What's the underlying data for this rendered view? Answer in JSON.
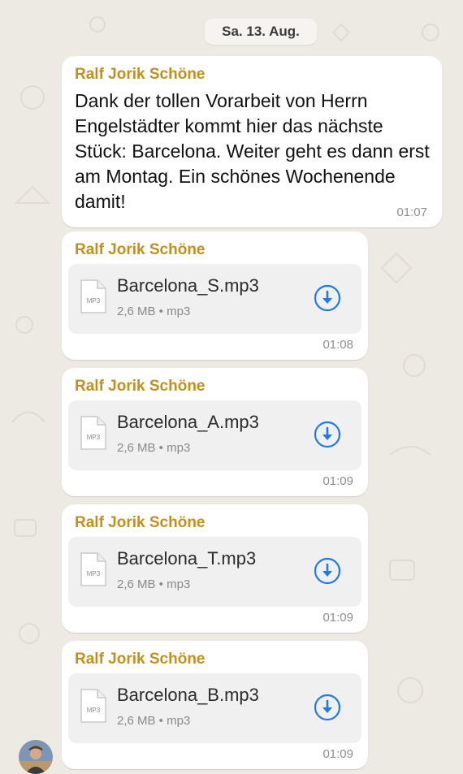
{
  "date_divider": "Sa. 13. Aug.",
  "messages": [
    {
      "sender": "Ralf Jorik Schöne",
      "text": "Dank der tollen Vorarbeit von Herrn Engelstädter kommt hier das nächste Stück: Barcelona. Weiter geht es dann erst am Montag. Ein schönes Wochenende damit!",
      "time": "01:07"
    }
  ],
  "files": [
    {
      "sender": "Ralf Jorik Schöne",
      "name": "Barcelona_S.mp3",
      "meta": "2,6 MB • mp3",
      "type_label": "MP3",
      "time": "01:08"
    },
    {
      "sender": "Ralf Jorik Schöne",
      "name": "Barcelona_A.mp3",
      "meta": "2,6 MB • mp3",
      "type_label": "MP3",
      "time": "01:09"
    },
    {
      "sender": "Ralf Jorik Schöne",
      "name": "Barcelona_T.mp3",
      "meta": "2,6 MB • mp3",
      "type_label": "MP3",
      "time": "01:09"
    },
    {
      "sender": "Ralf Jorik Schöne",
      "name": "Barcelona_B.mp3",
      "meta": "2,6 MB • mp3",
      "type_label": "MP3",
      "time": "01:09"
    }
  ],
  "colors": {
    "sender_name": "#c2901b",
    "download_accent": "#1f7be8",
    "chat_background": "#ede9e3"
  },
  "icons": {
    "file": "document-icon",
    "download": "download-icon"
  }
}
